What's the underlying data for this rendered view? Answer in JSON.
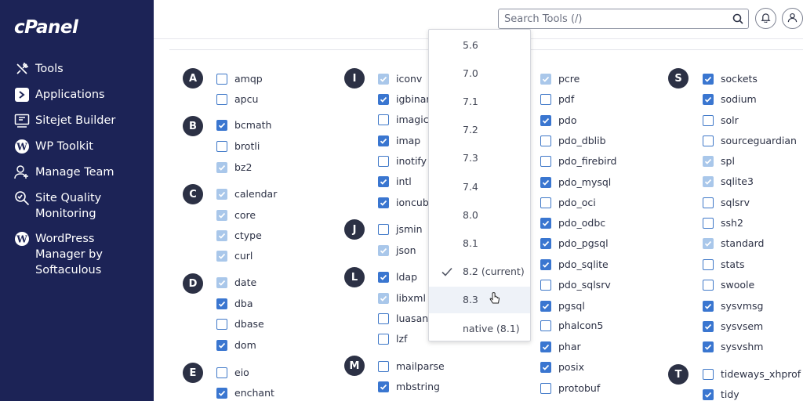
{
  "brand": {
    "logo_text": "cPanel"
  },
  "sidebar": {
    "items": [
      {
        "label": "Tools",
        "icon": "tools-icon"
      },
      {
        "label": "Applications",
        "icon": "applications-icon"
      },
      {
        "label": "Sitejet Builder",
        "icon": "sitejet-icon"
      },
      {
        "label": "WP Toolkit",
        "icon": "wordpress-icon"
      },
      {
        "label": "Manage Team",
        "icon": "team-icon"
      },
      {
        "label": "Site Quality\nMonitoring",
        "icon": "site-quality-icon"
      },
      {
        "label": "WordPress\nManager by\nSoftaculous",
        "icon": "wordpress-icon"
      }
    ]
  },
  "header": {
    "search_placeholder": "Search Tools (/)",
    "search_icon": "search-icon",
    "notifications_icon": "bell-icon",
    "user_icon": "user-icon"
  },
  "colors": {
    "sidebar_bg": "#1c2356",
    "checkbox_checked": "#3a76d0",
    "checkbox_disabled": "#a9c7ea"
  },
  "version_dropdown": {
    "options": [
      {
        "label": "5.6",
        "selected": false
      },
      {
        "label": "7.0",
        "selected": false
      },
      {
        "label": "7.1",
        "selected": false
      },
      {
        "label": "7.2",
        "selected": false
      },
      {
        "label": "7.3",
        "selected": false
      },
      {
        "label": "7.4",
        "selected": false
      },
      {
        "label": "8.0",
        "selected": false
      },
      {
        "label": "8.1",
        "selected": false
      },
      {
        "label": "8.2 (current)",
        "selected": true
      },
      {
        "label": "8.3",
        "selected": false,
        "hovered": true
      },
      {
        "label": "native (8.1)",
        "selected": false
      }
    ]
  },
  "letters": [
    "A",
    "B",
    "C",
    "D",
    "E",
    "I",
    "J",
    "L",
    "M",
    "S",
    "T"
  ],
  "extensions": {
    "col1": [
      {
        "name": "amqp",
        "state": "unchecked"
      },
      {
        "name": "apcu",
        "state": "unchecked"
      },
      {
        "name": "bcmath",
        "state": "checked"
      },
      {
        "name": "brotli",
        "state": "unchecked"
      },
      {
        "name": "bz2",
        "state": "disabled"
      },
      {
        "name": "calendar",
        "state": "disabled"
      },
      {
        "name": "core",
        "state": "disabled"
      },
      {
        "name": "ctype",
        "state": "disabled"
      },
      {
        "name": "curl",
        "state": "disabled"
      },
      {
        "name": "date",
        "state": "disabled"
      },
      {
        "name": "dba",
        "state": "checked"
      },
      {
        "name": "dbase",
        "state": "unchecked"
      },
      {
        "name": "dom",
        "state": "checked"
      },
      {
        "name": "eio",
        "state": "unchecked"
      },
      {
        "name": "enchant",
        "state": "checked"
      }
    ],
    "col2": [
      {
        "name": "iconv",
        "state": "disabled"
      },
      {
        "name": "igbinary",
        "state": "checked"
      },
      {
        "name": "imagick",
        "state": "unchecked"
      },
      {
        "name": "imap",
        "state": "checked"
      },
      {
        "name": "inotify",
        "state": "unchecked"
      },
      {
        "name": "intl",
        "state": "checked"
      },
      {
        "name": "ioncube_",
        "state": "checked"
      },
      {
        "name": "jsmin",
        "state": "unchecked"
      },
      {
        "name": "json",
        "state": "disabled"
      },
      {
        "name": "ldap",
        "state": "checked"
      },
      {
        "name": "libxml",
        "state": "disabled"
      },
      {
        "name": "luasandl",
        "state": "unchecked"
      },
      {
        "name": "lzf",
        "state": "unchecked"
      },
      {
        "name": "mailparse",
        "state": "unchecked"
      },
      {
        "name": "mbstring",
        "state": "checked"
      }
    ],
    "col3": [
      {
        "name": "pcre",
        "state": "disabled"
      },
      {
        "name": "pdf",
        "state": "unchecked"
      },
      {
        "name": "pdo",
        "state": "checked"
      },
      {
        "name": "pdo_dblib",
        "state": "unchecked"
      },
      {
        "name": "pdo_firebird",
        "state": "unchecked"
      },
      {
        "name": "pdo_mysql",
        "state": "checked"
      },
      {
        "name": "pdo_oci",
        "state": "unchecked"
      },
      {
        "name": "pdo_odbc",
        "state": "checked"
      },
      {
        "name": "pdo_pgsql",
        "state": "checked"
      },
      {
        "name": "pdo_sqlite",
        "state": "checked"
      },
      {
        "name": "pdo_sqlsrv",
        "state": "unchecked"
      },
      {
        "name": "pgsql",
        "state": "checked"
      },
      {
        "name": "phalcon5",
        "state": "unchecked"
      },
      {
        "name": "phar",
        "state": "checked"
      },
      {
        "name": "posix",
        "state": "checked"
      },
      {
        "name": "protobuf",
        "state": "unchecked"
      }
    ],
    "col4": [
      {
        "name": "sockets",
        "state": "checked"
      },
      {
        "name": "sodium",
        "state": "checked"
      },
      {
        "name": "solr",
        "state": "unchecked"
      },
      {
        "name": "sourceguardian",
        "state": "unchecked"
      },
      {
        "name": "spl",
        "state": "disabled"
      },
      {
        "name": "sqlite3",
        "state": "disabled"
      },
      {
        "name": "sqlsrv",
        "state": "unchecked"
      },
      {
        "name": "ssh2",
        "state": "unchecked"
      },
      {
        "name": "standard",
        "state": "disabled"
      },
      {
        "name": "stats",
        "state": "unchecked"
      },
      {
        "name": "swoole",
        "state": "unchecked"
      },
      {
        "name": "sysvmsg",
        "state": "checked"
      },
      {
        "name": "sysvsem",
        "state": "checked"
      },
      {
        "name": "sysvshm",
        "state": "checked"
      },
      {
        "name": "tideways_xhprof",
        "state": "unchecked"
      },
      {
        "name": "tidy",
        "state": "checked"
      }
    ]
  }
}
